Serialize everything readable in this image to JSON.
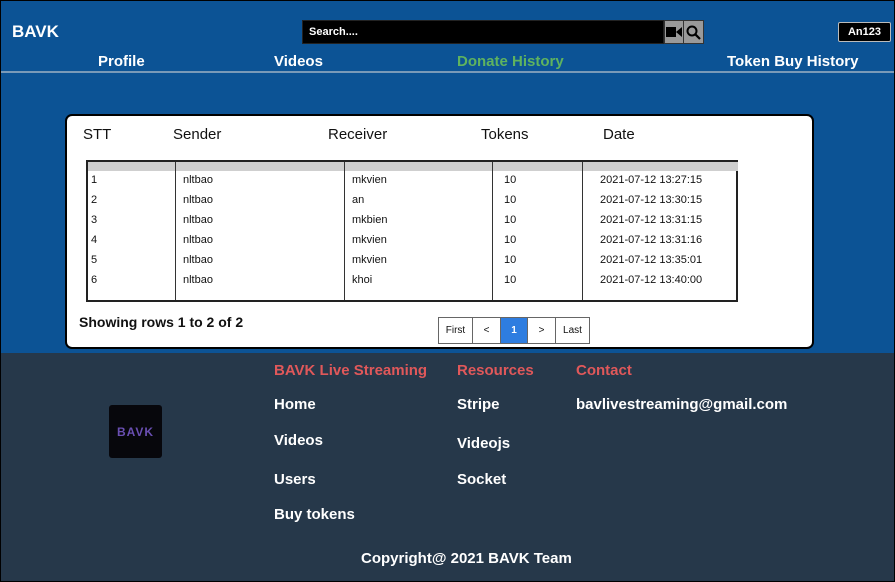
{
  "brand": "BAVK",
  "search": {
    "placeholder": "Search...."
  },
  "user": {
    "name": "An123"
  },
  "nav": [
    "Profile",
    "Videos",
    "Donate History",
    "Token Buy History"
  ],
  "table": {
    "columns": [
      "STT",
      "Sender",
      "Receiver",
      "Tokens",
      "Date"
    ],
    "rows": [
      [
        "1",
        "nltbao",
        "mkvien",
        "10",
        "2021-07-12 13:27:15"
      ],
      [
        "2",
        "nltbao",
        "an",
        "10",
        "2021-07-12 13:30:15"
      ],
      [
        "3",
        "nltbao",
        "mkbien",
        "10",
        "2021-07-12 13:31:15"
      ],
      [
        "4",
        "nltbao",
        "mkvien",
        "10",
        "2021-07-12 13:31:16"
      ],
      [
        "5",
        "nltbao",
        "mkvien",
        "10",
        "2021-07-12 13:35:01"
      ],
      [
        "6",
        "nltbao",
        "khoi",
        "10",
        "2021-07-12 13:40:00"
      ]
    ]
  },
  "pagination": {
    "summary": "Showing rows 1 to 2 of 2",
    "first": "First",
    "prev": "<",
    "current": "1",
    "next": ">",
    "last": "Last"
  },
  "footer": {
    "logo_text": "BAVK",
    "col1_title": "BAVK Live Streaming",
    "col1_links": [
      "Home",
      "Videos",
      "Users",
      "Buy tokens"
    ],
    "col2_title": "Resources",
    "col2_links": [
      "Stripe",
      "Videojs",
      "Socket"
    ],
    "col3_title": "Contact",
    "email": "bavlivestreaming@gmail.com",
    "copyright": "Copyright@ 2021 BAVK Team"
  },
  "colors": {
    "header_bg": "#0c5395",
    "footer_bg": "#26384a",
    "active_nav": "#5fb35f",
    "footer_heading": "#e0585a",
    "page_current": "#2e7de0"
  }
}
